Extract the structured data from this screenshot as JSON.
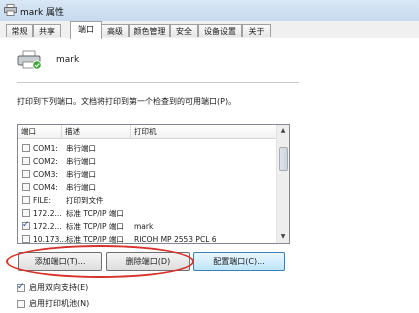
{
  "window": {
    "title": "mark 属性"
  },
  "tabs": [
    {
      "label": "常规",
      "active": false
    },
    {
      "label": "共享",
      "active": false
    },
    {
      "label": "端口",
      "active": true
    },
    {
      "label": "高级",
      "active": false
    },
    {
      "label": "颜色管理",
      "active": false
    },
    {
      "label": "安全",
      "active": false
    },
    {
      "label": "设备设置",
      "active": false
    },
    {
      "label": "关于",
      "active": false
    }
  ],
  "printer": {
    "name": "mark",
    "icon": "printer-icon"
  },
  "instruction": "打印到下列端口。文档将打印到第一个检查到的可用端口(P)。",
  "port_list": {
    "columns": [
      "端口",
      "描述",
      "打印机"
    ],
    "rows": [
      {
        "port": "COM1:",
        "description": "串行端口",
        "printer": "",
        "checked": false
      },
      {
        "port": "COM2:",
        "description": "串行端口",
        "printer": "",
        "checked": false
      },
      {
        "port": "COM3:",
        "description": "串行端口",
        "printer": "",
        "checked": false
      },
      {
        "port": "COM4:",
        "description": "串行端口",
        "printer": "",
        "checked": false
      },
      {
        "port": "FILE:",
        "description": "打印到文件",
        "printer": "",
        "checked": false
      },
      {
        "port": "172.2...",
        "description": "标准 TCP/IP 端口",
        "printer": "",
        "checked": false
      },
      {
        "port": "172.2...",
        "description": "标准 TCP/IP 端口",
        "printer": "mark",
        "checked": true
      },
      {
        "port": "10.173...",
        "description": "标准 TCP/IP 端口",
        "printer": "RICOH MP 2553 PCL 6",
        "checked": false
      }
    ]
  },
  "buttons": {
    "add_port": "添加端口(T)...",
    "delete_port": "删除端口(D)",
    "configure_port": "配置端口(C)..."
  },
  "options": {
    "bidirectional": {
      "label": "启用双向支持(E)",
      "checked": true
    },
    "pooling": {
      "label": "启用打印机池(N)",
      "checked": false
    }
  },
  "colors": {
    "annotation": "#d7322b",
    "check": "#1b4f9c",
    "button_focus": "#3c7fb1"
  }
}
